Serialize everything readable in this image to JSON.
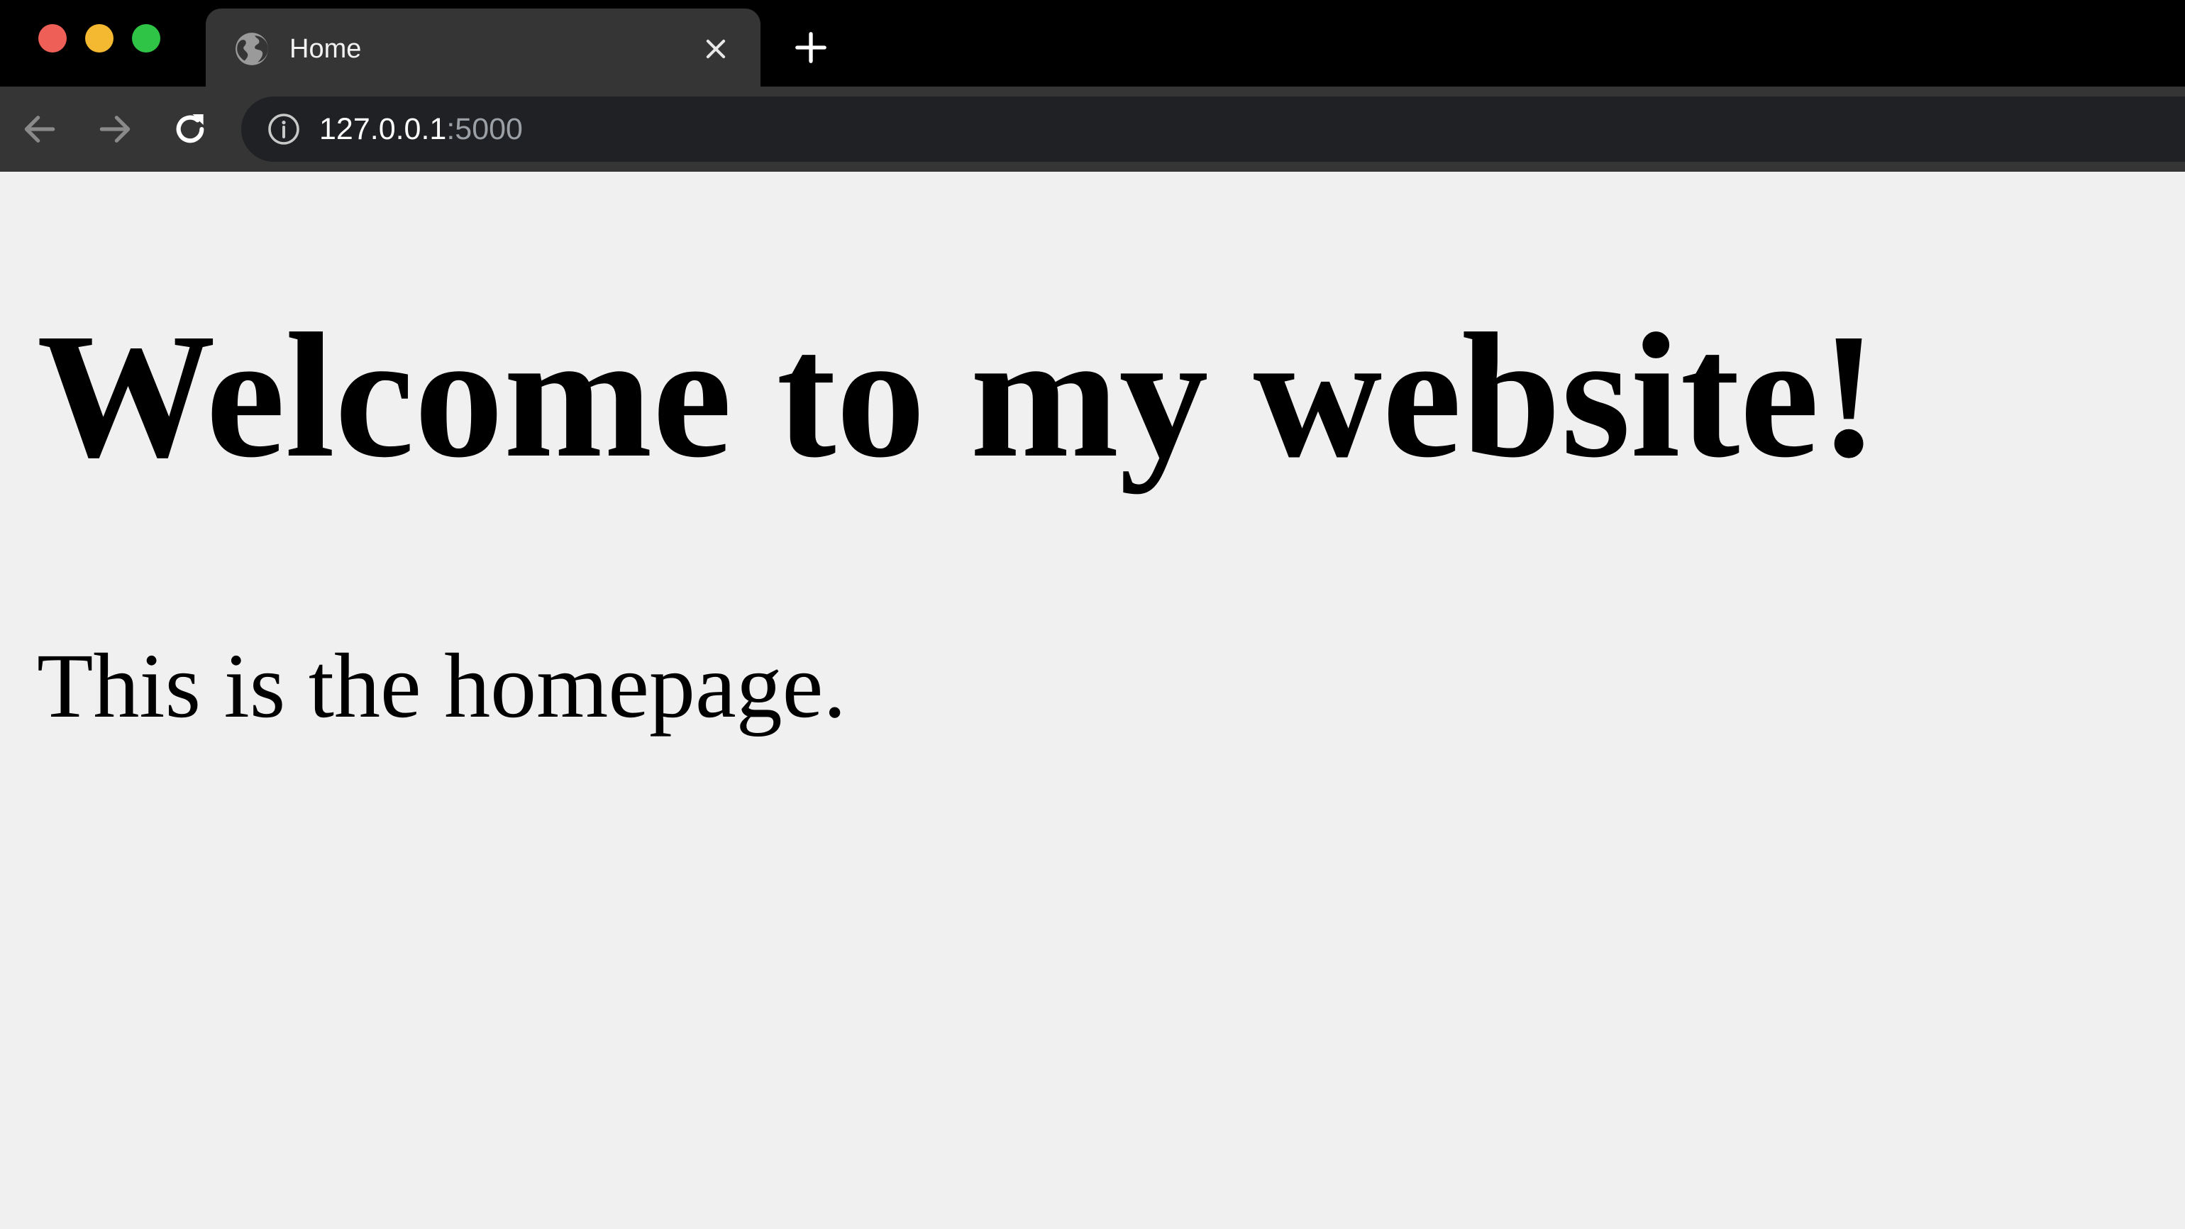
{
  "window": {
    "traffic_lights": {
      "close_color": "#ed5f57",
      "minimize_color": "#f4b930",
      "maximize_color": "#2fc445"
    }
  },
  "tab": {
    "title": "Home",
    "favicon": "globe-icon",
    "close_icon": "close-icon"
  },
  "new_tab": {
    "icon": "plus-icon"
  },
  "toolbar": {
    "back_icon": "arrow-left-icon",
    "forward_icon": "arrow-right-icon",
    "reload_icon": "reload-icon"
  },
  "address_bar": {
    "security_icon": "info-icon",
    "url_host": "127.0.0.1",
    "url_port": ":5000"
  },
  "page": {
    "heading": "Welcome to my website!",
    "paragraph": "This is the homepage."
  }
}
